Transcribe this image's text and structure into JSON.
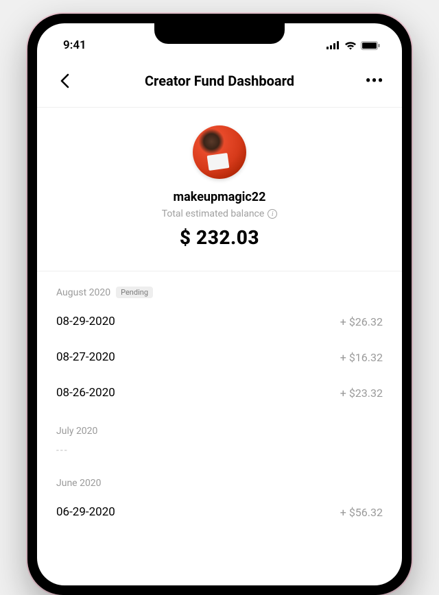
{
  "status_bar": {
    "time": "9:41"
  },
  "header": {
    "title": "Creator Fund Dashboard"
  },
  "profile": {
    "username": "makeupmagic22",
    "balance_label": "Total estimated balance",
    "balance_amount": "$ 232.03"
  },
  "badges": {
    "pending": "Pending"
  },
  "months": {
    "aug": {
      "label": "August 2020",
      "pending": true
    },
    "jul": {
      "label": "July 2020",
      "empty_marker": "---"
    },
    "jun": {
      "label": "June 2020"
    }
  },
  "transactions": {
    "aug": [
      {
        "date": "08-29-2020",
        "amount": "+ $26.32"
      },
      {
        "date": "08-27-2020",
        "amount": "+ $16.32"
      },
      {
        "date": "08-26-2020",
        "amount": "+ $23.32"
      }
    ],
    "jun": [
      {
        "date": "06-29-2020",
        "amount": "+ $56.32"
      }
    ]
  }
}
